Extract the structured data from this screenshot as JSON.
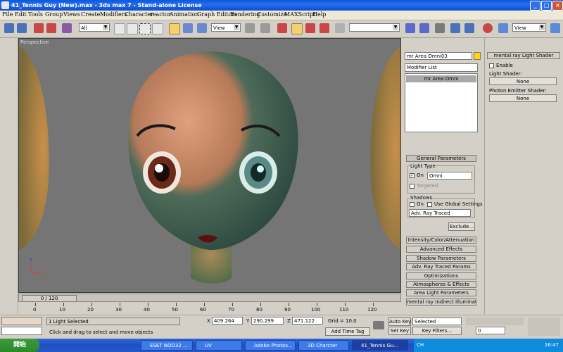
{
  "window": {
    "title": "41_Tennis Guy (New).max - 3ds max 7 - Stand-alone License",
    "buttons": {
      "minimize": "_",
      "maximize": "□",
      "close": "×"
    }
  },
  "menu": [
    "File",
    "Edit",
    "Tools",
    "Group",
    "Views",
    "Create",
    "Modifiers",
    "Character",
    "reactor",
    "Animation",
    "Graph Editors",
    "Rendering",
    "Customize",
    "MAXScript",
    "Help"
  ],
  "toolbar": {
    "selection_filter": "All",
    "ref_coord": "View",
    "named_selection": "",
    "render_view": "View"
  },
  "viewport": {
    "label": "Perspective",
    "axis": {
      "x": "x",
      "y": "y",
      "z": "z"
    }
  },
  "timeline": {
    "frame": "0 / 120",
    "ticks": [
      "0",
      "10",
      "20",
      "30",
      "40",
      "50",
      "60",
      "70",
      "80",
      "90",
      "100",
      "110",
      "120"
    ]
  },
  "command_panel": {
    "object_name": "mr Area Omni03",
    "object_color": "#ffd800",
    "modifier_list": "Modifier List",
    "stack_items": [
      "mr Area Omni"
    ],
    "rollouts": {
      "general": "General Parameters",
      "light_type_group": "Light Type",
      "on_label": "On",
      "light_type": "Omni",
      "targeted": "Targeted",
      "shadows_group": "Shadows",
      "shadows_on": "On",
      "use_global": "Use Global Settings",
      "shadow_type": "Adv. Ray Traced",
      "exclude": "Exclude...",
      "closed": [
        "Intensity/Color/Attenuation",
        "Advanced Effects",
        "Shadow Parameters",
        "Adv. Ray Traced Params",
        "Optimizations",
        "Atmospheres & Effects",
        "Area Light Parameters",
        "mental ray Indirect Illumination"
      ]
    }
  },
  "shader_panel": {
    "title": "mental ray Light Shader",
    "enable": "Enable",
    "light_shader_label": "Light Shader:",
    "light_shader_value": "None",
    "photon_label": "Photon Emitter Shader:",
    "photon_value": "None"
  },
  "status": {
    "selection": "1 Light Selected",
    "prompt": "Click and drag to select and move objects",
    "x_label": "X",
    "x": "409.264",
    "y_label": "Y",
    "y": "290.299",
    "z_label": "Z",
    "z": "471.122",
    "grid": "Grid = 10.0",
    "add_time_tag": "Add Time Tag",
    "auto_key": "Auto Key",
    "set_key": "Set Key",
    "key_mode": "Selected",
    "key_filters": "Key Filters...",
    "frame_field": "0"
  },
  "taskbar": {
    "start": "開始",
    "tasks": [
      "ESET NOD32 ...",
      "UV",
      "Adobe Photos...",
      "3D Charcter",
      "41_Tennis Gu..."
    ],
    "lang": "CH",
    "clock": "16:47"
  }
}
